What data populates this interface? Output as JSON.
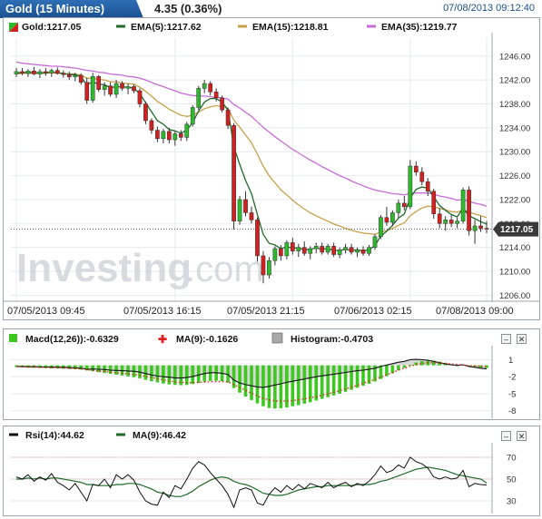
{
  "header": {
    "title": "Gold (15 Minutes)",
    "change": "4.35 (0.36%)",
    "timestamp": "07/08/2013 09:12:40"
  },
  "main_legend": [
    {
      "label": "Gold:1217.05",
      "color": "#1a7a1a"
    },
    {
      "label": "EMA(5):1217.62",
      "color": "#1f6b2a"
    },
    {
      "label": "EMA(15):1218.81",
      "color": "#c8a04a"
    },
    {
      "label": "EMA(35):1219.77",
      "color": "#c86bd8"
    }
  ],
  "main_y_ticks": [
    "1246.00",
    "1242.00",
    "1238.00",
    "1234.00",
    "1230.00",
    "1226.00",
    "1222.00",
    "1218.00",
    "1214.00",
    "1210.00",
    "1206.00"
  ],
  "x_ticks": [
    "07/05/2013 09:45",
    "07/05/2013 16:15",
    "07/05/2013 21:15",
    "07/06/2013 02:15",
    "07/08/2013 09:00"
  ],
  "price_tag": "1217.05",
  "watermark": {
    "part1": "Investing",
    "part2": ".com"
  },
  "macd_legend": [
    {
      "label": "Macd(12,26)):-0.6329",
      "color": "#3cc81e"
    },
    {
      "label": "MA(9):-0.1626",
      "color": "#e02020"
    },
    {
      "label": "Histogram:-0.4703",
      "color": "#9a9a9a"
    }
  ],
  "macd_y_ticks": [
    "1",
    "-2",
    "-5",
    "-8"
  ],
  "rsi_legend": [
    {
      "label": "Rsi(14):44.62",
      "color": "#111111"
    },
    {
      "label": "MA(9):46.42",
      "color": "#1f6b2a"
    }
  ],
  "rsi_y_ticks": [
    "70",
    "50",
    "30"
  ],
  "controls": {
    "minimize": "–",
    "close": "✕"
  },
  "chart_data": [
    {
      "type": "candlestick",
      "title": "Gold (15 Minutes)",
      "ylim": [
        1205,
        1249
      ],
      "candles": [
        [
          1243.0,
          1244.0,
          1242.5,
          1243.4
        ],
        [
          1243.4,
          1244.0,
          1242.8,
          1243.1
        ],
        [
          1243.1,
          1243.8,
          1242.5,
          1243.5
        ],
        [
          1243.5,
          1244.2,
          1242.8,
          1243.0
        ],
        [
          1243.0,
          1243.8,
          1242.3,
          1243.4
        ],
        [
          1243.4,
          1244.0,
          1242.7,
          1243.2
        ],
        [
          1243.2,
          1243.9,
          1242.5,
          1243.6
        ],
        [
          1243.6,
          1244.1,
          1242.9,
          1243.1
        ],
        [
          1243.1,
          1243.6,
          1242.4,
          1242.9
        ],
        [
          1242.9,
          1243.4,
          1242.0,
          1242.5
        ],
        [
          1242.5,
          1243.2,
          1241.8,
          1242.8
        ],
        [
          1242.8,
          1243.1,
          1241.2,
          1241.6
        ],
        [
          1241.6,
          1242.4,
          1238.0,
          1238.6
        ],
        [
          1238.6,
          1243.2,
          1238.2,
          1242.6
        ],
        [
          1242.6,
          1242.8,
          1240.0,
          1240.4
        ],
        [
          1240.4,
          1241.6,
          1239.4,
          1241.0
        ],
        [
          1241.0,
          1241.6,
          1239.2,
          1239.6
        ],
        [
          1239.6,
          1242.0,
          1239.0,
          1241.4
        ],
        [
          1241.4,
          1241.8,
          1240.2,
          1240.6
        ],
        [
          1240.6,
          1241.4,
          1239.6,
          1240.9
        ],
        [
          1240.9,
          1241.2,
          1239.8,
          1240.2
        ],
        [
          1240.2,
          1240.6,
          1237.4,
          1238.0
        ],
        [
          1238.0,
          1238.4,
          1234.6,
          1235.2
        ],
        [
          1235.2,
          1235.6,
          1233.0,
          1233.6
        ],
        [
          1233.6,
          1234.2,
          1231.6,
          1232.2
        ],
        [
          1232.2,
          1233.8,
          1231.4,
          1233.4
        ],
        [
          1233.4,
          1234.0,
          1231.4,
          1232.0
        ],
        [
          1232.0,
          1233.4,
          1231.0,
          1233.0
        ],
        [
          1233.0,
          1233.6,
          1231.8,
          1232.4
        ],
        [
          1232.4,
          1235.0,
          1231.8,
          1234.6
        ],
        [
          1234.6,
          1237.8,
          1234.2,
          1237.4
        ],
        [
          1237.4,
          1241.0,
          1237.0,
          1240.6
        ],
        [
          1240.6,
          1242.0,
          1239.8,
          1241.4
        ],
        [
          1241.4,
          1241.8,
          1239.4,
          1240.0
        ],
        [
          1240.0,
          1240.6,
          1238.4,
          1239.0
        ],
        [
          1239.0,
          1239.4,
          1236.6,
          1237.0
        ],
        [
          1237.0,
          1237.4,
          1233.8,
          1234.4
        ],
        [
          1234.4,
          1234.8,
          1217.0,
          1218.4
        ],
        [
          1218.4,
          1222.6,
          1217.8,
          1222.0
        ],
        [
          1222.0,
          1223.4,
          1219.2,
          1219.8
        ],
        [
          1219.8,
          1220.8,
          1218.0,
          1218.6
        ],
        [
          1218.6,
          1219.0,
          1211.6,
          1212.6
        ],
        [
          1212.6,
          1213.4,
          1208.0,
          1209.4
        ],
        [
          1209.4,
          1212.4,
          1208.8,
          1211.8
        ],
        [
          1211.8,
          1214.2,
          1211.0,
          1213.8
        ],
        [
          1213.8,
          1214.4,
          1211.8,
          1212.6
        ],
        [
          1212.6,
          1215.2,
          1212.0,
          1214.8
        ],
        [
          1214.8,
          1215.6,
          1212.8,
          1213.4
        ],
        [
          1213.4,
          1214.6,
          1212.4,
          1214.0
        ],
        [
          1214.0,
          1215.0,
          1212.6,
          1213.0
        ],
        [
          1213.0,
          1214.2,
          1212.0,
          1213.8
        ],
        [
          1213.8,
          1214.8,
          1213.0,
          1214.2
        ],
        [
          1214.2,
          1214.8,
          1212.8,
          1213.2
        ],
        [
          1213.2,
          1214.6,
          1212.8,
          1214.2
        ],
        [
          1214.2,
          1214.8,
          1212.4,
          1212.8
        ],
        [
          1212.8,
          1214.0,
          1212.2,
          1213.6
        ],
        [
          1213.6,
          1214.6,
          1213.0,
          1214.0
        ],
        [
          1214.0,
          1214.6,
          1212.8,
          1213.2
        ],
        [
          1213.2,
          1214.0,
          1212.4,
          1213.6
        ],
        [
          1213.6,
          1214.2,
          1212.6,
          1213.0
        ],
        [
          1213.0,
          1214.4,
          1212.6,
          1214.0
        ],
        [
          1214.0,
          1216.2,
          1213.6,
          1215.8
        ],
        [
          1215.8,
          1219.4,
          1215.4,
          1219.0
        ],
        [
          1219.0,
          1220.8,
          1217.6,
          1218.2
        ],
        [
          1218.2,
          1220.2,
          1217.6,
          1219.8
        ],
        [
          1219.8,
          1222.0,
          1219.0,
          1221.4
        ],
        [
          1221.4,
          1222.6,
          1220.2,
          1220.8
        ],
        [
          1220.8,
          1228.6,
          1220.4,
          1227.6
        ],
        [
          1227.6,
          1228.4,
          1226.0,
          1226.6
        ],
        [
          1226.6,
          1227.4,
          1224.4,
          1225.0
        ],
        [
          1225.0,
          1225.6,
          1222.6,
          1223.4
        ],
        [
          1223.4,
          1223.8,
          1218.8,
          1219.6
        ],
        [
          1219.6,
          1220.6,
          1217.2,
          1218.0
        ],
        [
          1218.0,
          1219.2,
          1216.8,
          1218.6
        ],
        [
          1218.6,
          1219.4,
          1217.4,
          1218.0
        ],
        [
          1218.0,
          1219.0,
          1217.2,
          1218.4
        ],
        [
          1218.4,
          1224.0,
          1218.0,
          1223.6
        ],
        [
          1223.6,
          1224.2,
          1216.0,
          1216.8
        ],
        [
          1216.8,
          1218.6,
          1214.6,
          1217.6
        ],
        [
          1217.6,
          1219.2,
          1216.6,
          1217.2
        ],
        [
          1217.2,
          1218.4,
          1216.4,
          1217.05
        ]
      ],
      "ema5": [
        1243.2,
        1243.2,
        1243.3,
        1243.2,
        1243.2,
        1243.2,
        1243.3,
        1243.2,
        1243.1,
        1242.9,
        1242.9,
        1242.5,
        1241.2,
        1241.7,
        1241.3,
        1241.2,
        1240.7,
        1240.9,
        1240.8,
        1240.8,
        1240.6,
        1239.7,
        1238.2,
        1236.7,
        1235.2,
        1234.6,
        1233.7,
        1233.5,
        1233.1,
        1233.6,
        1234.9,
        1236.8,
        1238.3,
        1238.9,
        1238.9,
        1238.3,
        1237.0,
        1230.8,
        1227.9,
        1225.2,
        1223.0,
        1219.5,
        1216.2,
        1214.7,
        1214.4,
        1213.8,
        1214.1,
        1213.9,
        1213.9,
        1213.6,
        1213.7,
        1213.9,
        1213.7,
        1213.8,
        1213.5,
        1213.5,
        1213.7,
        1213.5,
        1213.6,
        1213.4,
        1213.6,
        1214.3,
        1215.9,
        1216.7,
        1217.7,
        1218.9,
        1219.6,
        1222.3,
        1223.7,
        1224.1,
        1223.9,
        1222.5,
        1221.0,
        1220.2,
        1219.5,
        1219.1,
        1220.6,
        1219.3,
        1218.8,
        1218.3,
        1217.9
      ],
      "ema15": [
        1243.0,
        1243.1,
        1243.1,
        1243.1,
        1243.1,
        1243.1,
        1243.2,
        1243.1,
        1243.1,
        1243.0,
        1243.0,
        1242.8,
        1242.3,
        1242.3,
        1242.1,
        1242.0,
        1241.7,
        1241.7,
        1241.5,
        1241.4,
        1241.3,
        1240.8,
        1240.1,
        1239.3,
        1238.4,
        1237.8,
        1237.1,
        1236.6,
        1236.1,
        1235.9,
        1236.1,
        1236.6,
        1237.2,
        1237.5,
        1237.7,
        1237.6,
        1237.2,
        1235.3,
        1234.1,
        1232.8,
        1231.5,
        1229.6,
        1227.6,
        1226.0,
        1224.8,
        1223.6,
        1222.8,
        1221.9,
        1221.1,
        1220.4,
        1219.8,
        1219.3,
        1218.8,
        1218.4,
        1217.9,
        1217.6,
        1217.2,
        1216.9,
        1216.6,
        1216.4,
        1216.3,
        1216.2,
        1216.6,
        1216.8,
        1217.2,
        1217.7,
        1218.1,
        1219.3,
        1220.0,
        1220.6,
        1220.9,
        1220.8,
        1220.5,
        1220.3,
        1220.0,
        1219.9,
        1220.3,
        1219.9,
        1219.6,
        1219.3,
        1219.0
      ],
      "ema35": [
        1245.0,
        1244.8,
        1244.7,
        1244.6,
        1244.5,
        1244.4,
        1244.3,
        1244.3,
        1244.2,
        1244.1,
        1244.0,
        1243.8,
        1243.6,
        1243.5,
        1243.3,
        1243.2,
        1243.0,
        1242.9,
        1242.8,
        1242.6,
        1242.5,
        1242.3,
        1242.0,
        1241.6,
        1241.2,
        1240.9,
        1240.5,
        1240.2,
        1239.8,
        1239.6,
        1239.4,
        1239.3,
        1239.3,
        1239.2,
        1239.1,
        1239.0,
        1238.8,
        1237.9,
        1237.3,
        1236.6,
        1235.9,
        1235.0,
        1234.1,
        1233.3,
        1232.5,
        1231.8,
        1231.1,
        1230.4,
        1229.8,
        1229.2,
        1228.6,
        1228.1,
        1227.5,
        1227.0,
        1226.5,
        1226.0,
        1225.6,
        1225.1,
        1224.7,
        1224.3,
        1223.9,
        1223.6,
        1223.4,
        1223.2,
        1223.0,
        1222.9,
        1222.8,
        1223.0,
        1223.1,
        1223.1,
        1223.1,
        1222.9,
        1222.6,
        1222.4,
        1222.2,
        1221.9,
        1222.0,
        1221.7,
        1221.4,
        1221.2,
        1220.9
      ]
    },
    {
      "type": "bar+line",
      "title": "Macd(12,26))",
      "ylim": [
        -9,
        2.5
      ],
      "histogram": [
        -0.3,
        -0.35,
        -0.4,
        -0.42,
        -0.45,
        -0.5,
        -0.52,
        -0.55,
        -0.58,
        -0.62,
        -0.68,
        -0.75,
        -0.9,
        -1.05,
        -1.2,
        -1.35,
        -1.5,
        -1.65,
        -1.8,
        -1.95,
        -2.1,
        -2.3,
        -2.55,
        -2.8,
        -3.0,
        -3.2,
        -3.35,
        -3.45,
        -3.5,
        -3.45,
        -3.3,
        -3.1,
        -2.9,
        -2.75,
        -2.7,
        -2.8,
        -3.05,
        -4.0,
        -4.8,
        -5.5,
        -6.1,
        -6.7,
        -7.2,
        -7.5,
        -7.6,
        -7.55,
        -7.4,
        -7.2,
        -7.0,
        -6.75,
        -6.5,
        -6.2,
        -5.9,
        -5.6,
        -5.3,
        -5.0,
        -4.65,
        -4.3,
        -3.95,
        -3.6,
        -3.25,
        -2.85,
        -2.4,
        -1.9,
        -1.4,
        -0.9,
        -0.45,
        0.1,
        0.5,
        0.75,
        0.85,
        0.8,
        0.65,
        0.45,
        0.2,
        -0.05,
        0.1,
        -0.1,
        -0.25,
        -0.4,
        -0.47
      ],
      "macd": [
        -0.2,
        -0.2,
        -0.25,
        -0.25,
        -0.3,
        -0.3,
        -0.3,
        -0.35,
        -0.35,
        -0.4,
        -0.45,
        -0.5,
        -0.7,
        -0.65,
        -0.7,
        -0.75,
        -0.85,
        -0.9,
        -0.95,
        -1.0,
        -1.05,
        -1.2,
        -1.45,
        -1.7,
        -1.9,
        -2.0,
        -2.1,
        -2.2,
        -2.25,
        -2.15,
        -1.95,
        -1.7,
        -1.45,
        -1.3,
        -1.3,
        -1.4,
        -1.6,
        -2.6,
        -3.1,
        -3.4,
        -3.6,
        -3.8,
        -3.9,
        -3.7,
        -3.45,
        -3.25,
        -3.0,
        -2.8,
        -2.6,
        -2.4,
        -2.2,
        -2.0,
        -1.85,
        -1.7,
        -1.55,
        -1.4,
        -1.25,
        -1.1,
        -0.95,
        -0.85,
        -0.7,
        -0.5,
        -0.2,
        0.05,
        0.3,
        0.55,
        0.7,
        1.0,
        1.05,
        1.0,
        0.9,
        0.7,
        0.45,
        0.25,
        0.1,
        0.0,
        0.1,
        -0.2,
        -0.35,
        -0.5,
        -0.63
      ],
      "signal": [
        -0.2,
        -0.25,
        -0.3,
        -0.3,
        -0.35,
        -0.35,
        -0.4,
        -0.4,
        -0.45,
        -0.5,
        -0.55,
        -0.6,
        -0.75,
        -0.9,
        -1.0,
        -1.1,
        -1.2,
        -1.3,
        -1.4,
        -1.5,
        -1.6,
        -1.75,
        -1.95,
        -2.15,
        -2.35,
        -2.55,
        -2.75,
        -2.9,
        -3.0,
        -3.05,
        -3.05,
        -3.0,
        -2.95,
        -2.9,
        -2.85,
        -2.85,
        -2.9,
        -3.4,
        -3.9,
        -4.4,
        -4.9,
        -5.4,
        -5.8,
        -6.1,
        -6.25,
        -6.3,
        -6.3,
        -6.2,
        -6.05,
        -5.9,
        -5.7,
        -5.5,
        -5.25,
        -5.0,
        -4.75,
        -4.45,
        -4.15,
        -3.85,
        -3.5,
        -3.15,
        -2.8,
        -2.45,
        -2.05,
        -1.65,
        -1.25,
        -0.85,
        -0.5,
        -0.15,
        0.15,
        0.35,
        0.45,
        0.45,
        0.4,
        0.35,
        0.25,
        0.15,
        0.05,
        -0.05,
        -0.1,
        -0.15,
        -0.16
      ]
    },
    {
      "type": "line",
      "title": "Rsi(14)",
      "ylim": [
        20,
        80
      ],
      "rsi": [
        52,
        50,
        54,
        48,
        52,
        49,
        55,
        47,
        44,
        40,
        46,
        38,
        30,
        45,
        44,
        50,
        42,
        54,
        50,
        54,
        49,
        38,
        30,
        27,
        26,
        38,
        33,
        44,
        41,
        50,
        60,
        66,
        63,
        56,
        50,
        44,
        36,
        24,
        40,
        42,
        40,
        28,
        26,
        36,
        42,
        38,
        44,
        40,
        45,
        41,
        46,
        44,
        42,
        47,
        42,
        45,
        47,
        43,
        46,
        44,
        48,
        54,
        62,
        56,
        58,
        63,
        60,
        70,
        66,
        64,
        60,
        52,
        50,
        52,
        50,
        51,
        58,
        43,
        46,
        45,
        44.6
      ],
      "rsi_ma": [
        50,
        50,
        51,
        50,
        51,
        50,
        51,
        51,
        50,
        49,
        48,
        47,
        45,
        45,
        44,
        44,
        44,
        45,
        45,
        46,
        46,
        45,
        43,
        41,
        38,
        37,
        35,
        34,
        34,
        36,
        39,
        43,
        46,
        49,
        51,
        52,
        51,
        48,
        46,
        45,
        43,
        40,
        37,
        36,
        35,
        35,
        36,
        38,
        40,
        41,
        42,
        43,
        43,
        44,
        44,
        44,
        44,
        44,
        45,
        45,
        45,
        46,
        48,
        49,
        51,
        53,
        55,
        57,
        59,
        60,
        61,
        60,
        59,
        58,
        56,
        54,
        53,
        52,
        51,
        50,
        46.4
      ]
    }
  ]
}
